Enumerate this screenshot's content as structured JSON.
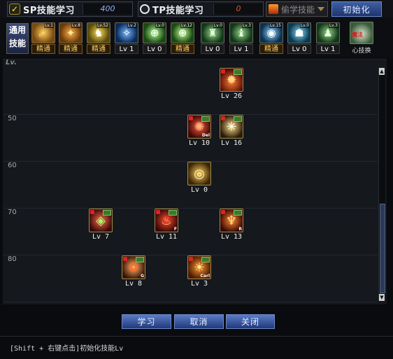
{
  "header": {
    "sp_label": "SP技能学习",
    "sp_value": "400",
    "tp_label": "TP技能学习",
    "tp_value": "0",
    "steal_skill_label": "偷学技能",
    "reset_label": "初始化"
  },
  "skill_bar": {
    "general_line1": "通用",
    "general_line2": "技能",
    "items": [
      {
        "tag": "精通",
        "elite": true,
        "mini": "Lv.1"
      },
      {
        "tag": "精通",
        "elite": true,
        "mini": "Lv.8"
      },
      {
        "tag": "精通",
        "elite": true,
        "mini": "Lv.52"
      },
      {
        "tag": "Lv 1",
        "elite": false,
        "mini": "Lv.2"
      },
      {
        "tag": "Lv 0",
        "elite": false,
        "mini": "Lv.0"
      },
      {
        "tag": "精通",
        "elite": true,
        "mini": "Lv.12"
      },
      {
        "tag": "Lv 0",
        "elite": false,
        "mini": "Lv.0"
      },
      {
        "tag": "Lv 1",
        "elite": false,
        "mini": "Lv.3"
      },
      {
        "tag": "精通",
        "elite": true,
        "mini": "Lv.15"
      },
      {
        "tag": "Lv 0",
        "elite": false,
        "mini": "Lv.0"
      },
      {
        "tag": "Lv 1",
        "elite": false,
        "mini": "Lv.3"
      }
    ],
    "recast_label": "魔法",
    "recast_caption": "心技换"
  },
  "grid": {
    "lv_header": "Lv.",
    "level_labels": [
      "50",
      "60",
      "70",
      "80"
    ],
    "skills": [
      {
        "lv": "Lv 26",
        "mini": "",
        "row": "top"
      },
      {
        "lv": "Lv 10",
        "mini": "Del",
        "row": "50"
      },
      {
        "lv": "Lv 16",
        "mini": "",
        "row": "50"
      },
      {
        "lv": "Lv 0",
        "mini": "",
        "row": "60"
      },
      {
        "lv": "Lv 7",
        "mini": "",
        "row": "70"
      },
      {
        "lv": "Lv 11",
        "mini": "F",
        "row": "70"
      },
      {
        "lv": "Lv 13",
        "mini": "R",
        "row": "70"
      },
      {
        "lv": "Lv 8",
        "mini": "G",
        "row": "80"
      },
      {
        "lv": "Lv 3",
        "mini": "Carl",
        "row": "80"
      }
    ]
  },
  "buttons": {
    "learn": "学习",
    "cancel": "取消",
    "close": "关闭"
  },
  "footer": {
    "hint": "[Shift + 右键点击]初始化技能Lv"
  },
  "colors": {
    "accent_blue": "#3f5fa2",
    "elite_gold": "#ffd060",
    "sp_value": "#8fb7ff",
    "tp_value": "#e05b2a"
  }
}
